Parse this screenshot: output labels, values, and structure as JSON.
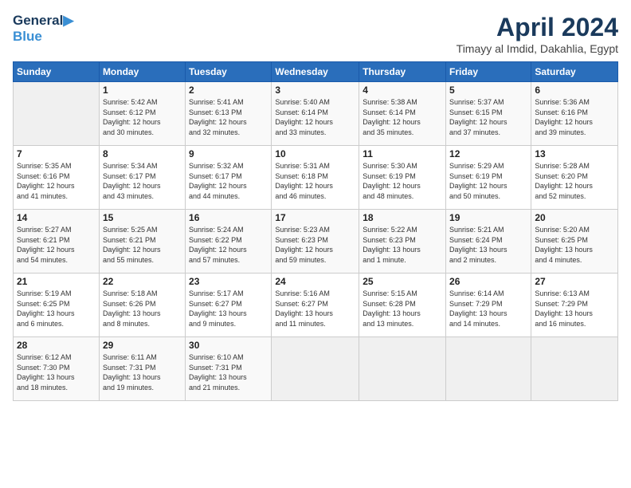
{
  "header": {
    "logo_line1": "General",
    "logo_line2": "Blue",
    "title": "April 2024",
    "location": "Timayy al Imdid, Dakahlia, Egypt"
  },
  "columns": [
    "Sunday",
    "Monday",
    "Tuesday",
    "Wednesday",
    "Thursday",
    "Friday",
    "Saturday"
  ],
  "weeks": [
    [
      {
        "num": "",
        "info": ""
      },
      {
        "num": "1",
        "info": "Sunrise: 5:42 AM\nSunset: 6:12 PM\nDaylight: 12 hours\nand 30 minutes."
      },
      {
        "num": "2",
        "info": "Sunrise: 5:41 AM\nSunset: 6:13 PM\nDaylight: 12 hours\nand 32 minutes."
      },
      {
        "num": "3",
        "info": "Sunrise: 5:40 AM\nSunset: 6:14 PM\nDaylight: 12 hours\nand 33 minutes."
      },
      {
        "num": "4",
        "info": "Sunrise: 5:38 AM\nSunset: 6:14 PM\nDaylight: 12 hours\nand 35 minutes."
      },
      {
        "num": "5",
        "info": "Sunrise: 5:37 AM\nSunset: 6:15 PM\nDaylight: 12 hours\nand 37 minutes."
      },
      {
        "num": "6",
        "info": "Sunrise: 5:36 AM\nSunset: 6:16 PM\nDaylight: 12 hours\nand 39 minutes."
      }
    ],
    [
      {
        "num": "7",
        "info": "Sunrise: 5:35 AM\nSunset: 6:16 PM\nDaylight: 12 hours\nand 41 minutes."
      },
      {
        "num": "8",
        "info": "Sunrise: 5:34 AM\nSunset: 6:17 PM\nDaylight: 12 hours\nand 43 minutes."
      },
      {
        "num": "9",
        "info": "Sunrise: 5:32 AM\nSunset: 6:17 PM\nDaylight: 12 hours\nand 44 minutes."
      },
      {
        "num": "10",
        "info": "Sunrise: 5:31 AM\nSunset: 6:18 PM\nDaylight: 12 hours\nand 46 minutes."
      },
      {
        "num": "11",
        "info": "Sunrise: 5:30 AM\nSunset: 6:19 PM\nDaylight: 12 hours\nand 48 minutes."
      },
      {
        "num": "12",
        "info": "Sunrise: 5:29 AM\nSunset: 6:19 PM\nDaylight: 12 hours\nand 50 minutes."
      },
      {
        "num": "13",
        "info": "Sunrise: 5:28 AM\nSunset: 6:20 PM\nDaylight: 12 hours\nand 52 minutes."
      }
    ],
    [
      {
        "num": "14",
        "info": "Sunrise: 5:27 AM\nSunset: 6:21 PM\nDaylight: 12 hours\nand 54 minutes."
      },
      {
        "num": "15",
        "info": "Sunrise: 5:25 AM\nSunset: 6:21 PM\nDaylight: 12 hours\nand 55 minutes."
      },
      {
        "num": "16",
        "info": "Sunrise: 5:24 AM\nSunset: 6:22 PM\nDaylight: 12 hours\nand 57 minutes."
      },
      {
        "num": "17",
        "info": "Sunrise: 5:23 AM\nSunset: 6:23 PM\nDaylight: 12 hours\nand 59 minutes."
      },
      {
        "num": "18",
        "info": "Sunrise: 5:22 AM\nSunset: 6:23 PM\nDaylight: 13 hours\nand 1 minute."
      },
      {
        "num": "19",
        "info": "Sunrise: 5:21 AM\nSunset: 6:24 PM\nDaylight: 13 hours\nand 2 minutes."
      },
      {
        "num": "20",
        "info": "Sunrise: 5:20 AM\nSunset: 6:25 PM\nDaylight: 13 hours\nand 4 minutes."
      }
    ],
    [
      {
        "num": "21",
        "info": "Sunrise: 5:19 AM\nSunset: 6:25 PM\nDaylight: 13 hours\nand 6 minutes."
      },
      {
        "num": "22",
        "info": "Sunrise: 5:18 AM\nSunset: 6:26 PM\nDaylight: 13 hours\nand 8 minutes."
      },
      {
        "num": "23",
        "info": "Sunrise: 5:17 AM\nSunset: 6:27 PM\nDaylight: 13 hours\nand 9 minutes."
      },
      {
        "num": "24",
        "info": "Sunrise: 5:16 AM\nSunset: 6:27 PM\nDaylight: 13 hours\nand 11 minutes."
      },
      {
        "num": "25",
        "info": "Sunrise: 5:15 AM\nSunset: 6:28 PM\nDaylight: 13 hours\nand 13 minutes."
      },
      {
        "num": "26",
        "info": "Sunrise: 6:14 AM\nSunset: 7:29 PM\nDaylight: 13 hours\nand 14 minutes."
      },
      {
        "num": "27",
        "info": "Sunrise: 6:13 AM\nSunset: 7:29 PM\nDaylight: 13 hours\nand 16 minutes."
      }
    ],
    [
      {
        "num": "28",
        "info": "Sunrise: 6:12 AM\nSunset: 7:30 PM\nDaylight: 13 hours\nand 18 minutes."
      },
      {
        "num": "29",
        "info": "Sunrise: 6:11 AM\nSunset: 7:31 PM\nDaylight: 13 hours\nand 19 minutes."
      },
      {
        "num": "30",
        "info": "Sunrise: 6:10 AM\nSunset: 7:31 PM\nDaylight: 13 hours\nand 21 minutes."
      },
      {
        "num": "",
        "info": ""
      },
      {
        "num": "",
        "info": ""
      },
      {
        "num": "",
        "info": ""
      },
      {
        "num": "",
        "info": ""
      }
    ]
  ]
}
